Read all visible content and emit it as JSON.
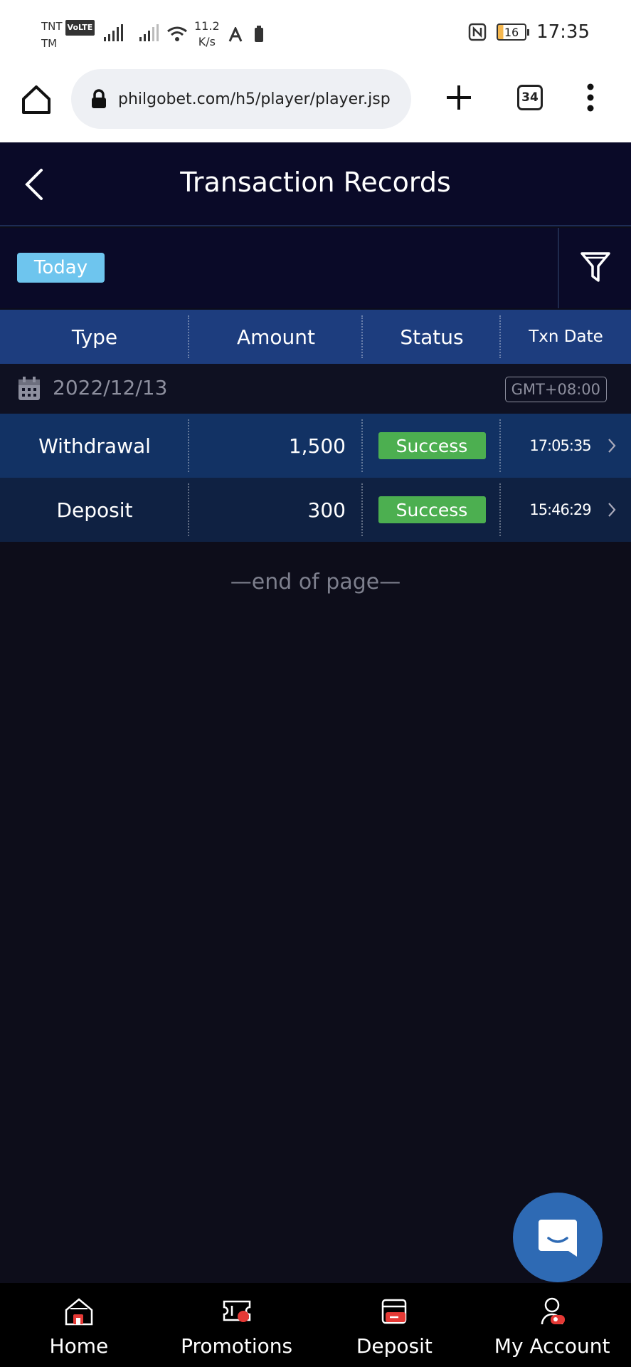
{
  "status_bar": {
    "carrier_line1": "TNT",
    "carrier_badge": "VoLTE",
    "carrier_line2": "TM",
    "speed_value": "11.2",
    "speed_unit": "K/s",
    "battery_level": "16",
    "time": "17:35"
  },
  "browser": {
    "url": "philgobet.com/h5/player/player.jsp",
    "tab_count": "34",
    "icons": [
      "home-icon",
      "lock-icon",
      "plus-icon",
      "tabs-icon",
      "more-vert-icon"
    ]
  },
  "header": {
    "title": "Transaction Records"
  },
  "filter": {
    "period_chip": "Today"
  },
  "table": {
    "columns": [
      "Type",
      "Amount",
      "Status",
      "Txn Date"
    ],
    "group_date": "2022/12/13",
    "timezone": "GMT+08:00",
    "rows": [
      {
        "type": "Withdrawal",
        "amount": "1,500",
        "status": "Success",
        "time": "17:05:35"
      },
      {
        "type": "Deposit",
        "amount": "300",
        "status": "Success",
        "time": "15:46:29"
      }
    ],
    "end_text": "—end of page—"
  },
  "bottom_nav": {
    "items": [
      {
        "label": "Home",
        "icon": "home-icon"
      },
      {
        "label": "Promotions",
        "icon": "ticket-icon"
      },
      {
        "label": "Deposit",
        "icon": "card-icon"
      },
      {
        "label": "My Account",
        "icon": "account-icon"
      }
    ]
  },
  "colors": {
    "accent": "#1d3d7e",
    "success": "#4caf50",
    "chip": "#6ec5ee",
    "nav_badge": "#e53935"
  }
}
